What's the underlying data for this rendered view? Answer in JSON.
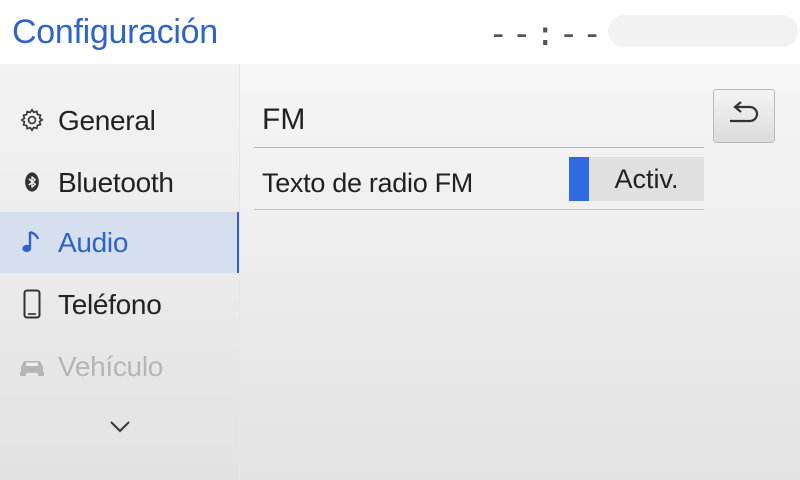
{
  "header": {
    "title": "Configuración",
    "clock": "--:--"
  },
  "sidebar": {
    "items": [
      {
        "label": "General",
        "icon": "gear-icon",
        "state": "normal"
      },
      {
        "label": "Bluetooth",
        "icon": "bluetooth-icon",
        "state": "normal"
      },
      {
        "label": "Audio",
        "icon": "music-note-icon",
        "state": "active"
      },
      {
        "label": "Teléfono",
        "icon": "phone-icon",
        "state": "normal"
      },
      {
        "label": "Vehículo",
        "icon": "car-icon",
        "state": "disabled"
      }
    ],
    "more_icon": "chevron-down-icon"
  },
  "main": {
    "section_title": "FM",
    "back_icon": "back-arrow-icon",
    "settings": [
      {
        "label": "Texto de radio FM",
        "value": "Activ."
      }
    ]
  },
  "colors": {
    "accent": "#2f63c7",
    "toggle_on": "#2f6ae0",
    "active_bg": "#d5dfee",
    "disabled_text": "#b5b5b5"
  }
}
